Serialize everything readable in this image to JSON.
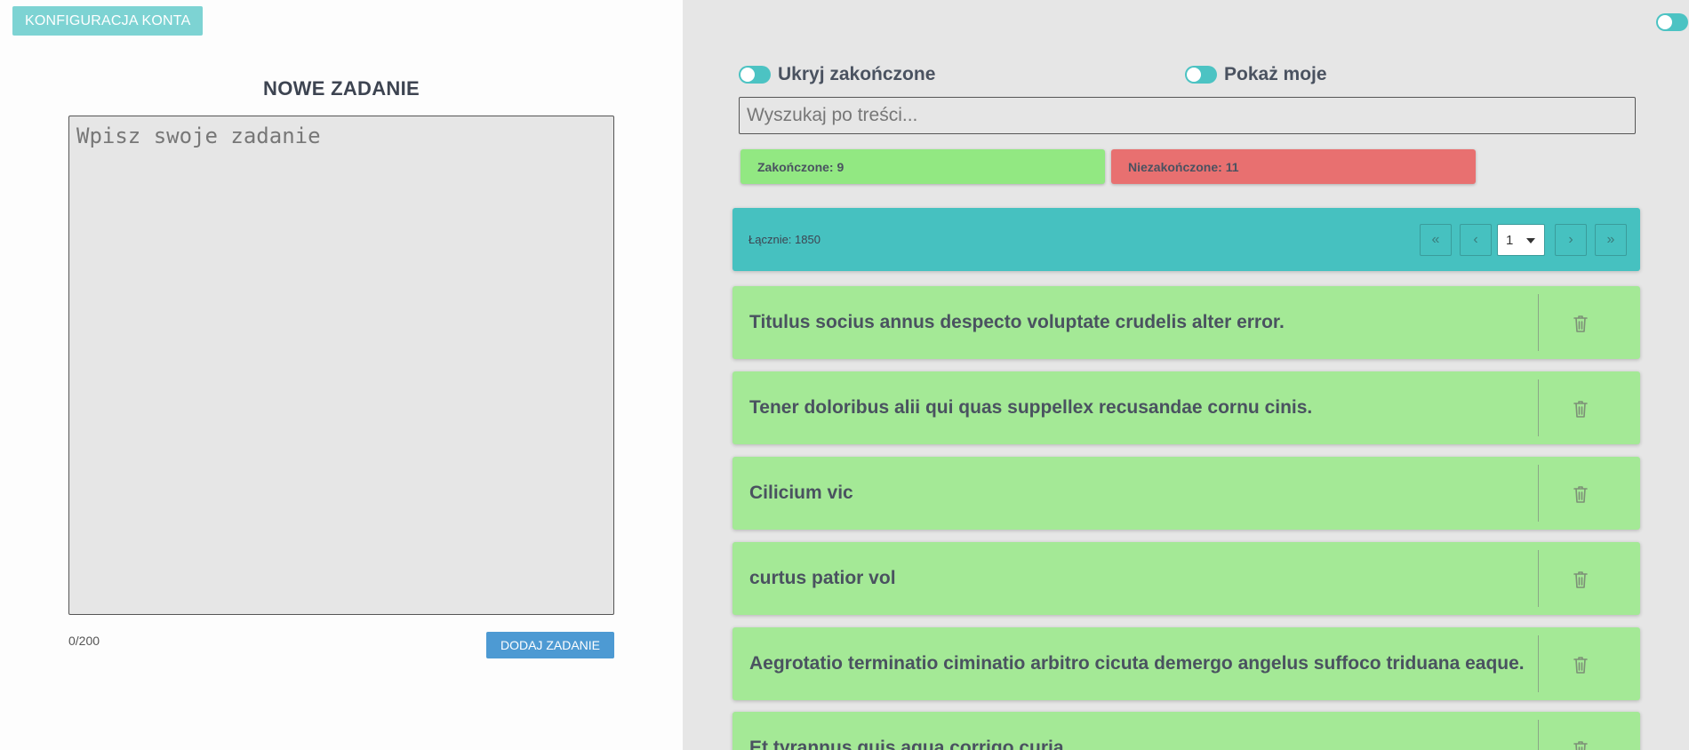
{
  "left": {
    "config_button": "KONFIGURACJA KONTA",
    "new_task_title": "NOWE ZADANIE",
    "textarea_placeholder": "Wpisz swoje zadanie",
    "char_count": "0/200",
    "add_button": "DODAJ ZADANIE"
  },
  "filters": {
    "hide_completed": "Ukryj zakończone",
    "show_mine": "Pokaż moje"
  },
  "search": {
    "placeholder": "Wyszukaj po treści..."
  },
  "stats": {
    "completed": "Zakończone: 9",
    "uncompleted": "Niezakończone: 11"
  },
  "pager": {
    "total": "Łącznie: 1850",
    "first": "«",
    "prev": "‹",
    "page": "1",
    "next": "›",
    "last": "»"
  },
  "tasks": [
    {
      "text": "Titulus socius annus despecto voluptate crudelis alter error."
    },
    {
      "text": "Tener doloribus alii qui quas suppellex recusandae cornu cinis."
    },
    {
      "text": "Cilicium vic"
    },
    {
      "text": "curtus patior vol"
    },
    {
      "text": "Aegrotatio terminatio ciminatio arbitro cicuta demergo angelus suffoco triduana eaque."
    },
    {
      "text": "Et tyrannus quis agua corrigo curia."
    }
  ],
  "colors": {
    "accent": "#46c1c0",
    "completed": "#92e882",
    "uncompleted": "#e87070",
    "task_bg": "#a4e996",
    "add_button": "#4d9ad3"
  },
  "icons": {
    "trash": "trash-icon",
    "toggle": "toggle-icon"
  }
}
